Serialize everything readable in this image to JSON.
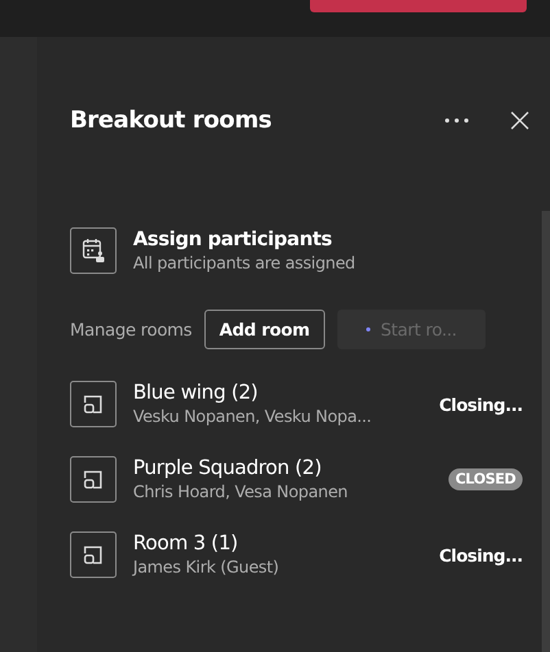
{
  "panel": {
    "title": "Breakout rooms"
  },
  "assign": {
    "title": "Assign participants",
    "subtitle": "All participants are assigned"
  },
  "manage": {
    "label": "Manage rooms",
    "add_button": "Add room",
    "start_button": {
      "label": "Start ro...",
      "disabled": true
    }
  },
  "rooms": [
    {
      "name": "Blue wing (2)",
      "participants": "Vesku Nopanen, Vesku Nopa...",
      "status": {
        "kind": "closing",
        "label": "Closing..."
      }
    },
    {
      "name": "Purple Squadron (2)",
      "participants": "Chris Hoard, Vesa Nopanen",
      "status": {
        "kind": "closed",
        "label": "CLOSED"
      }
    },
    {
      "name": "Room 3 (1)",
      "participants": "James Kirk (Guest)",
      "status": {
        "kind": "closing",
        "label": "Closing..."
      }
    }
  ]
}
